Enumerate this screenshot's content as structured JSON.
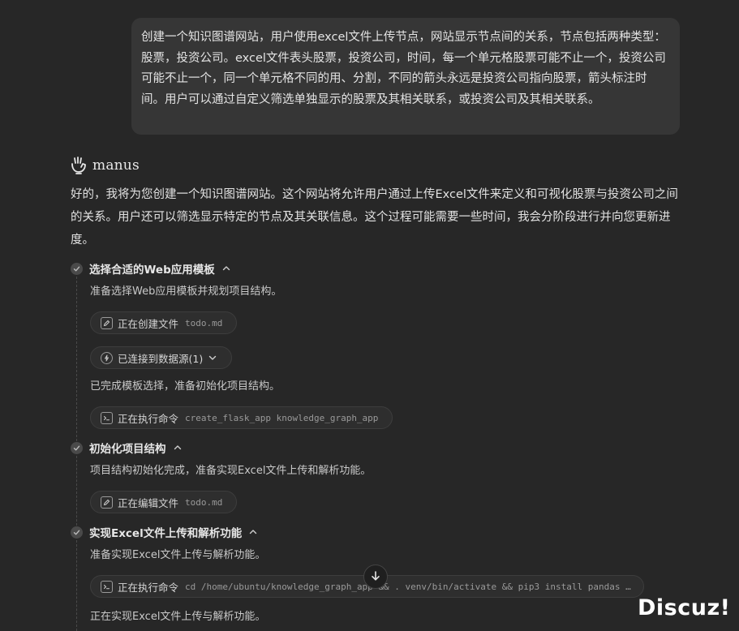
{
  "user_message": {
    "text": "创建一个知识图谱网站，用户使用excel文件上传节点，网站显示节点间的关系，节点包括两种类型：股票，投资公司。excel文件表头股票，投资公司，时间，每一个单元格股票可能不止一个，投资公司可能不止一个，同一个单元格不同的用、分割，不同的箭头永远是投资公司指向股票，箭头标注时间。用户可以通过自定义筛选单独显示的股票及其相关联系，或投资公司及其相关联系。"
  },
  "assistant": {
    "name": "manus",
    "intro": "好的，我将为您创建一个知识图谱网站。这个网站将允许用户通过上传Excel文件来定义和可视化股票与投资公司之间的关系。用户还可以筛选显示特定的节点及其关联信息。这个过程可能需要一些时间，我会分阶段进行并向您更新进度。"
  },
  "steps": [
    {
      "title": "选择合适的Web应用模板",
      "note1": "准备选择Web应用模板并规划项目结构。",
      "action1_label": "正在创建文件",
      "action1_code": "todo.md",
      "action2_label": "已连接到数据源(1)",
      "note2": "已完成模板选择，准备初始化项目结构。",
      "action3_label": "正在执行命令",
      "action3_code": "create_flask_app knowledge_graph_app"
    },
    {
      "title": "初始化项目结构",
      "note1": "项目结构初始化完成，准备实现Excel文件上传和解析功能。",
      "action1_label": "正在编辑文件",
      "action1_code": "todo.md"
    },
    {
      "title": "实现Excel文件上传和解析功能",
      "note1": "准备实现Excel文件上传与解析功能。",
      "action1_label": "正在执行命令",
      "action1_code": "cd /home/ubuntu/knowledge_graph_app && . venv/bin/activate && pip3 install pandas …",
      "note2": "正在实现Excel文件上传与解析功能。"
    }
  ],
  "watermark": "Discuz!"
}
